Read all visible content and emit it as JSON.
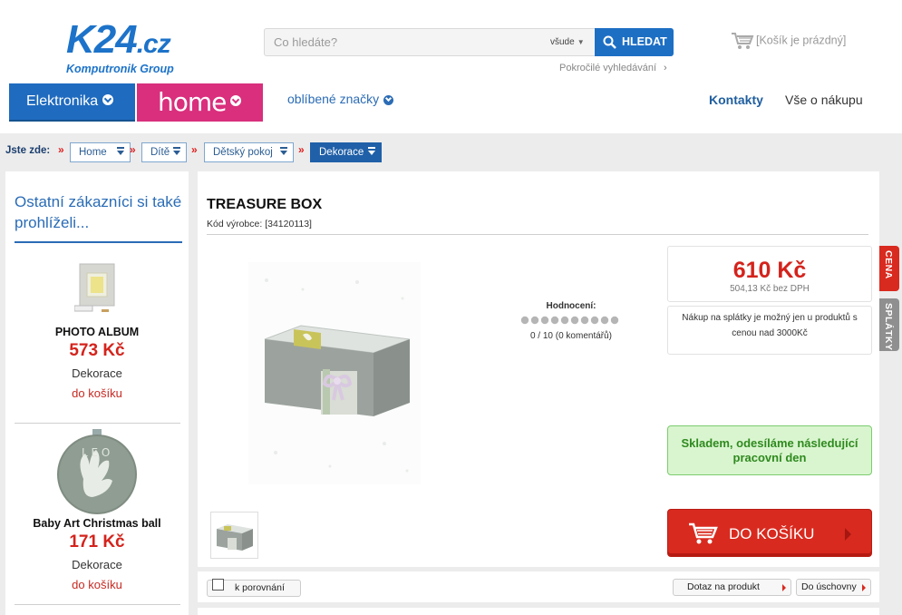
{
  "header": {
    "logo_main": "K24",
    "logo_tld": ".cz",
    "logo_sub": "Komputronik Group",
    "search_placeholder": "Co hledáte?",
    "search_scope": "všude",
    "search_button": "HLEDAT",
    "advanced_search": "Pokročilé vyhledávání",
    "cart": "[Košík je prázdný]"
  },
  "nav": {
    "elektronika": "Elektronika",
    "home": "home",
    "brands": "oblíbené značky",
    "contacts": "Kontakty",
    "about_shopping": "Vše o nákupu"
  },
  "breadcrumb": {
    "label": "Jste zde:",
    "items": [
      "Home",
      "Dítě",
      "Dětský pokoj",
      "Dekorace"
    ]
  },
  "sidebar": {
    "title": "Ostatní zákazníci si také prohlíželi...",
    "items": [
      {
        "name": "PHOTO ALBUM",
        "price": "573 Kč",
        "category": "Dekorace",
        "add": "do košíku"
      },
      {
        "name": "Baby Art Christmas ball",
        "price": "171 Kč",
        "category": "Dekorace",
        "add": "do košíku"
      }
    ]
  },
  "product": {
    "title": "TREASURE BOX",
    "code": "Kód výrobce: [34120113]",
    "rating_label": "Hodnocení:",
    "rating_value": "0 / 10 (0 komentářů)",
    "rating_stars": 0,
    "price": "610 Kč",
    "price_without_vat": "504,13 Kč bez DPH",
    "installment_note": "Nákup na splátky je možný jen u produktů s cenou nad 3000Kč",
    "stock": "Skladem, odesíláme následující pracovní den",
    "add_to_cart": "DO KOŠÍKU"
  },
  "side_tabs": {
    "price": "CENA",
    "installments": "SPLÁTKY"
  },
  "actions": {
    "compare": "k porovnání",
    "question": "Dotaz na produkt",
    "storage": "Do úschovny"
  },
  "colors": {
    "brand_blue": "#1d73c9",
    "home_pink": "#d92f7d",
    "price_red": "#d4231c",
    "stock_green": "#2f8a1f"
  }
}
